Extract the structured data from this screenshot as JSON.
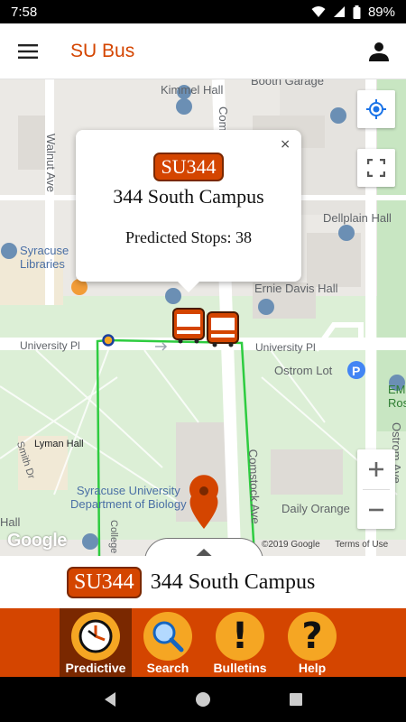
{
  "status_bar": {
    "time": "7:58",
    "battery": "89%"
  },
  "app_bar": {
    "title": "SU Bus"
  },
  "map": {
    "labels": {
      "kimmel_hall": "Kimmel Hall",
      "booth_garage": "Booth Garage",
      "comstock_ave_top": "Comstock Ave",
      "walnut_ave": "Walnut Ave",
      "dellplain_hall": "Dellplain Hall",
      "syracuse_libraries": "Syracuse\nLibraries",
      "ernie_davis_hall": "Ernie Davis Hall",
      "university_pl_left": "University Pl",
      "university_pl_right": "University Pl",
      "ostrom_lot": "Ostrom Lot",
      "ostrom_ave": "Ostrom Ave",
      "em_rose": "EM\nRose",
      "lyman_hall": "Lyman Hall",
      "comstock_ave_lower": "Comstock Ave",
      "syracuse_university_bio": "Syracuse University\nDepartment of Biology",
      "daily_orange": "Daily Orange",
      "smith_dr": "Smith Dr",
      "hall_partial": "Hall",
      "college_partial": "College"
    },
    "google_logo": "Google",
    "attribution": {
      "copyright": "©2019 Google",
      "terms": "Terms of Use"
    },
    "info_window": {
      "badge": "SU344",
      "route_name": "344 South Campus",
      "predicted_stops": "Predicted Stops: 38",
      "close": "×"
    }
  },
  "route_bar": {
    "badge": "SU344",
    "route_name": "344 South Campus"
  },
  "tabs": [
    {
      "label": "Predictive",
      "icon": "clock-icon",
      "active": true
    },
    {
      "label": "Search",
      "icon": "magnifier-icon",
      "active": false
    },
    {
      "label": "Bulletins",
      "icon": "exclamation-icon",
      "glyph": "!",
      "active": false
    },
    {
      "label": "Help",
      "icon": "question-icon",
      "glyph": "?",
      "active": false
    }
  ],
  "colors": {
    "brand_orange": "#d44500",
    "tab_active": "#7a2800",
    "icon_yellow": "#f5a623",
    "route_line": "#2ecc40"
  }
}
